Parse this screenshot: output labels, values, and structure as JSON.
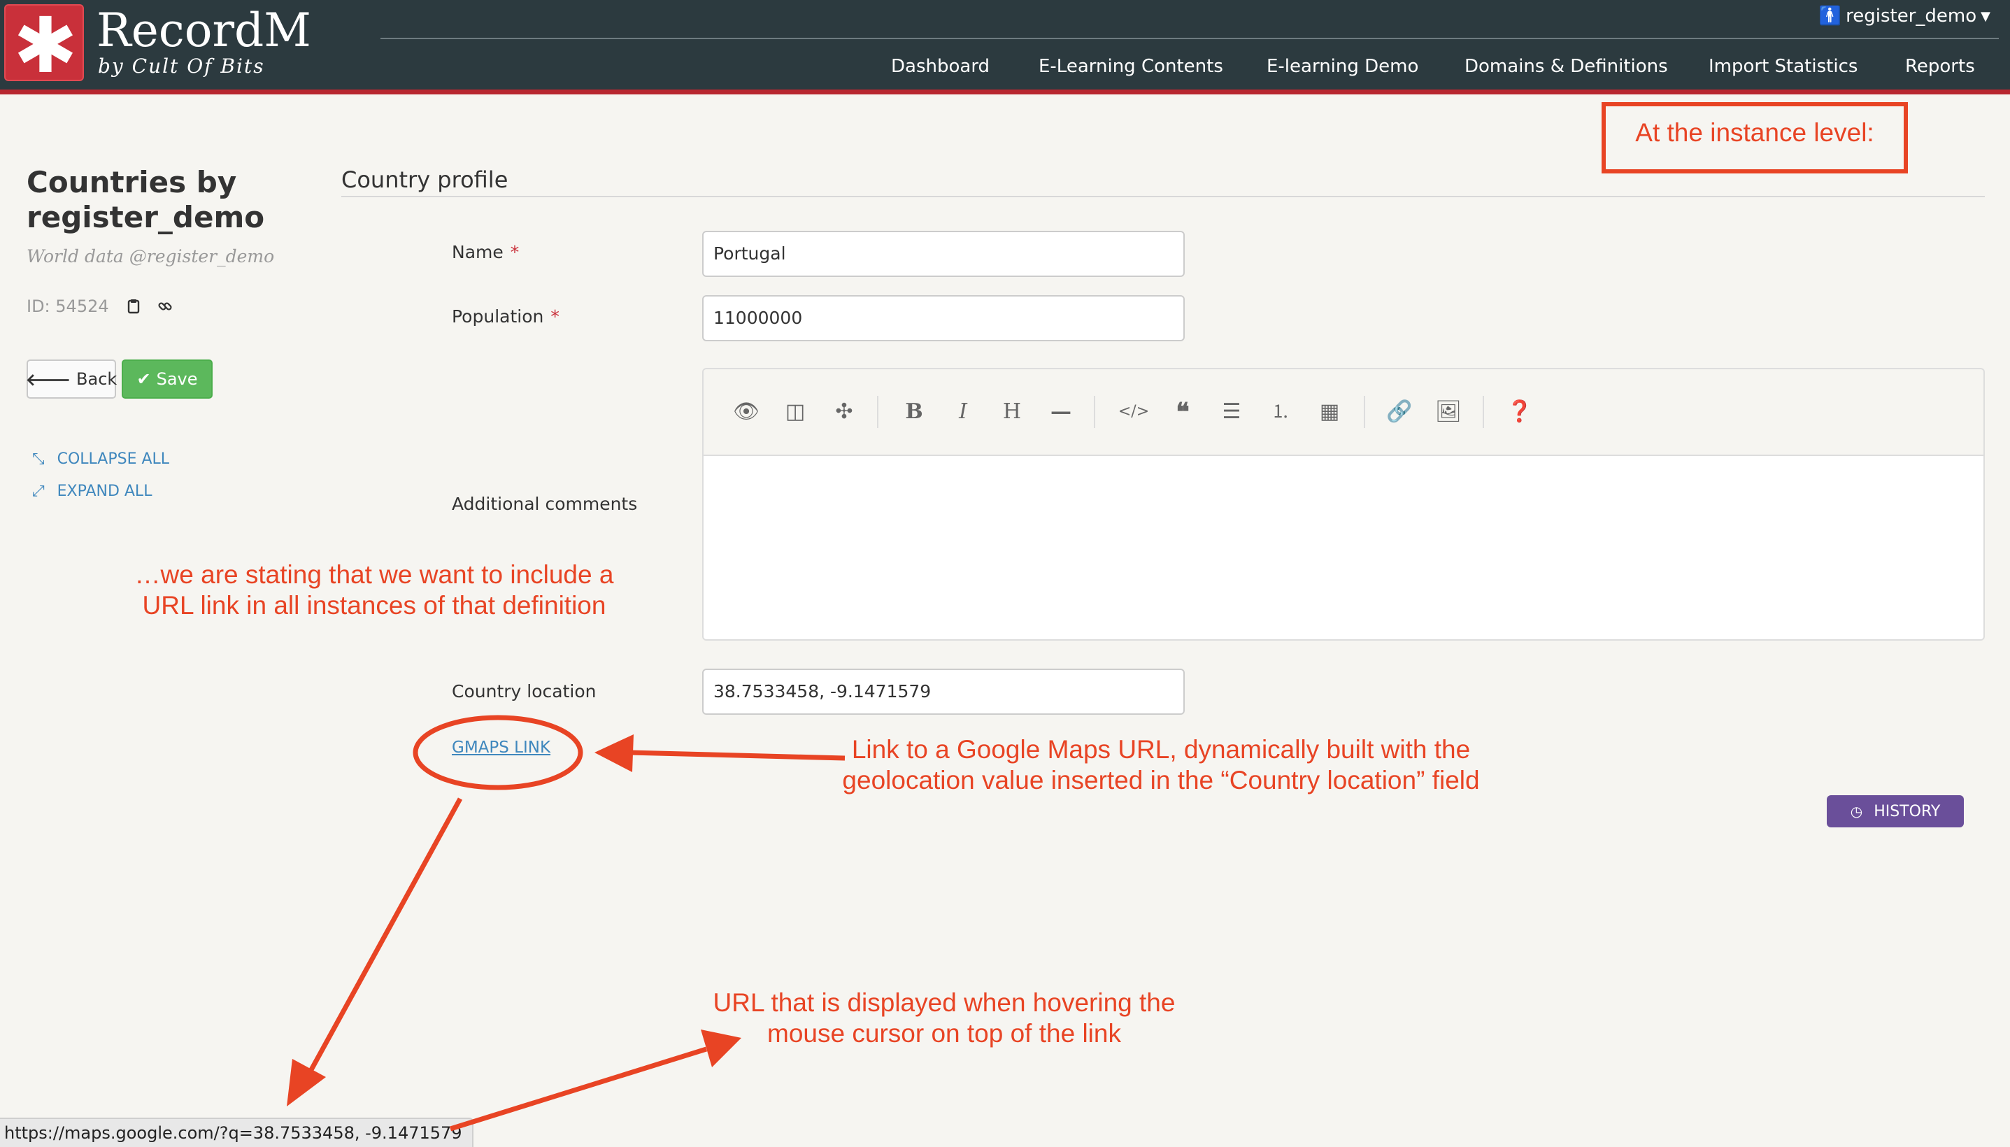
{
  "header": {
    "brand": "RecordM",
    "brand_sub": "by Cult Of Bits",
    "user": "register_demo",
    "nav": [
      "Dashboard",
      "E-Learning Contents",
      "E-learning Demo",
      "Domains & Definitions",
      "Import Statistics",
      "Reports"
    ]
  },
  "left": {
    "title": "Countries by register_demo",
    "subtitle": "World data @register_demo",
    "id_text": "ID: 54524",
    "back": "Back",
    "save": "Save",
    "collapse_all": "COLLAPSE ALL",
    "expand_all": "EXPAND ALL"
  },
  "form": {
    "section_title": "Country profile",
    "name_label": "Name",
    "name_value": "Portugal",
    "population_label": "Population",
    "population_value": "11000000",
    "required_mark": "*",
    "comments_label": "Additional comments",
    "location_label": "Country location",
    "location_value": "38.7533458, -9.1471579",
    "gmaps_link": "GMAPS LINK",
    "history": "HISTORY"
  },
  "statusbar": {
    "url": "https://maps.google.com/?q=38.7533458, -9.1471579"
  },
  "annotations": {
    "box": "At the instance level:",
    "left_line1": "…we are stating that we want to include a",
    "left_line2": "URL link in all instances of that definition",
    "link_line1": "Link to a Google Maps URL, dynamically built with the",
    "link_line2": "geolocation value inserted in the “Country location” field",
    "url_line1": "URL that is displayed when hovering the",
    "url_line2": "mouse cursor on top of the link"
  },
  "colors": {
    "annotation": "#e84424",
    "header": "#2c3a3f",
    "brand_red": "#c9303a",
    "link": "#3f87bd",
    "save": "#5cb85c",
    "history": "#6a4f9a"
  }
}
